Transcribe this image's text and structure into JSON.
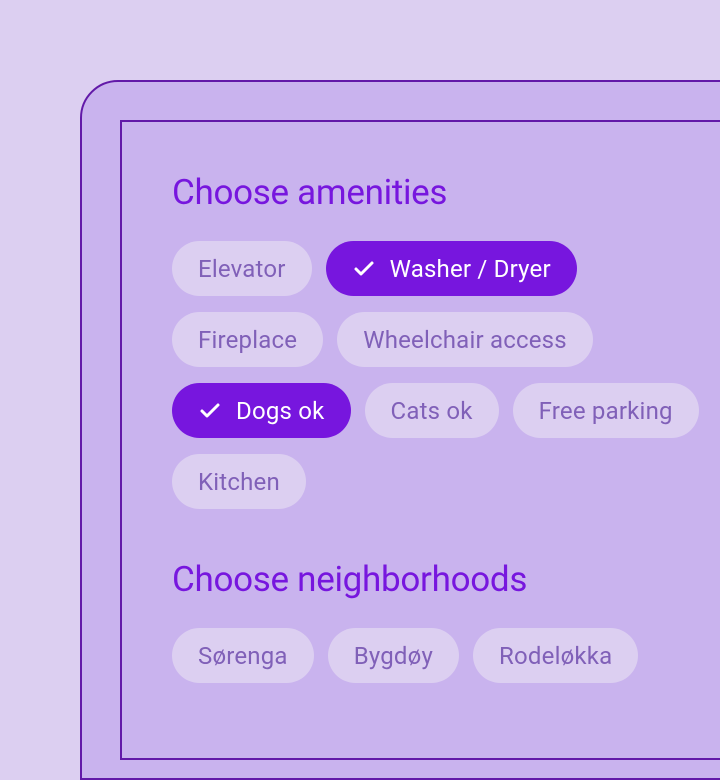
{
  "sections": {
    "amenities": {
      "title": "Choose amenities",
      "chips": [
        {
          "label": "Elevator",
          "selected": false
        },
        {
          "label": "Washer / Dryer",
          "selected": true
        },
        {
          "label": "Fireplace",
          "selected": false
        },
        {
          "label": "Wheelchair access",
          "selected": false
        },
        {
          "label": "Dogs ok",
          "selected": true
        },
        {
          "label": "Cats ok",
          "selected": false
        },
        {
          "label": "Free parking",
          "selected": false
        },
        {
          "label": "Kitchen",
          "selected": false
        }
      ]
    },
    "neighborhoods": {
      "title": "Choose neighborhoods",
      "chips": [
        {
          "label": "Sørenga",
          "selected": false
        },
        {
          "label": "Bygdøy",
          "selected": false
        },
        {
          "label": "Rodeløkka",
          "selected": false
        }
      ]
    }
  }
}
